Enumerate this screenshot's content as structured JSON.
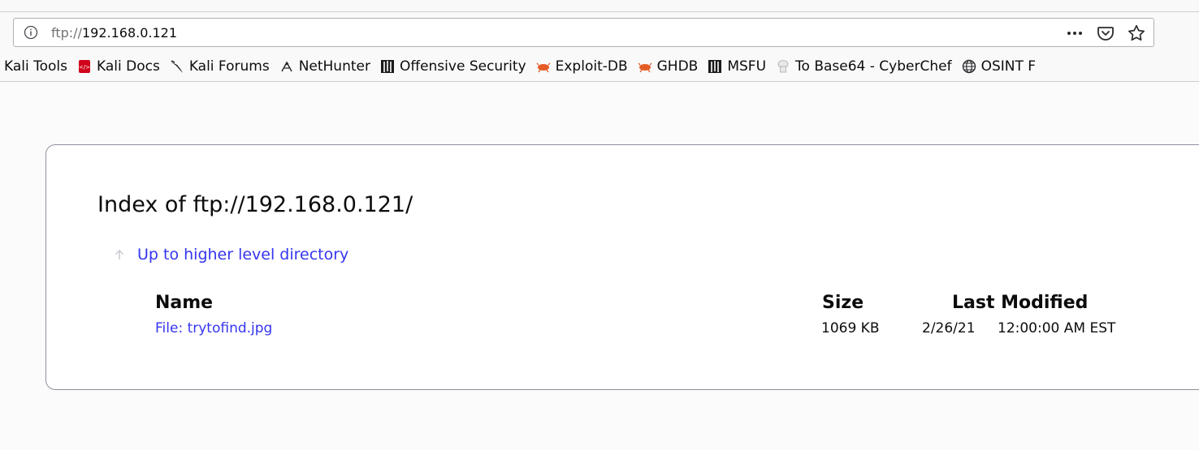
{
  "browser": {
    "url_scheme": "ftp://",
    "url_host": "192.168.0.121"
  },
  "bookmarks": [
    {
      "label": "Kali Tools",
      "icon": "none"
    },
    {
      "label": "Kali Docs",
      "icon": "kali-docs-icon"
    },
    {
      "label": "Kali Forums",
      "icon": "kali-dragon-icon"
    },
    {
      "label": "NetHunter",
      "icon": "nethunter-icon"
    },
    {
      "label": "Offensive Security",
      "icon": "offsec-icon"
    },
    {
      "label": "Exploit-DB",
      "icon": "exploitdb-bug-icon"
    },
    {
      "label": "GHDB",
      "icon": "ghdb-bug-icon"
    },
    {
      "label": "MSFU",
      "icon": "msfu-icon"
    },
    {
      "label": "To Base64 - CyberChef",
      "icon": "cyberchef-icon"
    },
    {
      "label": "OSINT F",
      "icon": "globe-icon"
    }
  ],
  "page": {
    "title": "Index of ftp://192.168.0.121/",
    "up_link": "Up to higher level directory",
    "columns": {
      "name": "Name",
      "size": "Size",
      "modified": "Last Modified"
    },
    "files": [
      {
        "name": "File: trytofind.jpg",
        "size": "1069 KB",
        "date": "2/26/21",
        "time": "12:00:00 AM EST"
      }
    ]
  },
  "colors": {
    "link": "#3535f0",
    "exploitdb_orange": "#e45c26"
  }
}
